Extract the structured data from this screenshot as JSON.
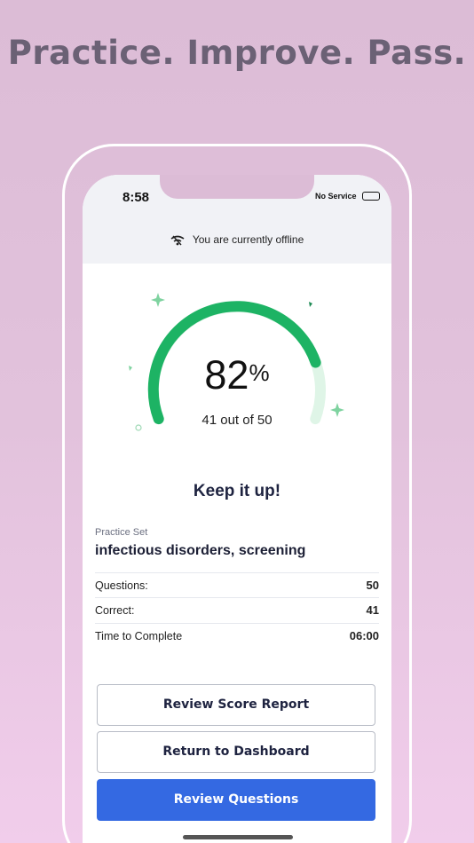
{
  "headline": "Practice. Improve. Pass.",
  "status_bar": {
    "time": "8:58",
    "carrier": "No Service"
  },
  "offline_banner": {
    "text": "You are currently offline",
    "icon": "wifi-off-icon"
  },
  "score": {
    "percent": "82",
    "percent_symbol": "%",
    "fraction": 0.82,
    "detail": "41 out of 50"
  },
  "message": "Keep it up!",
  "practice_set": {
    "label": "Practice Set",
    "name": "infectious disorders, screening"
  },
  "stats": [
    {
      "label": "Questions:",
      "value": "50"
    },
    {
      "label": "Correct:",
      "value": "41"
    },
    {
      "label": "Time to Complete",
      "value": "06:00"
    }
  ],
  "buttons": {
    "review_score": "Review Score Report",
    "dashboard": "Return to Dashboard",
    "review_questions": "Review Questions"
  },
  "colors": {
    "gauge_primary": "#1db364",
    "gauge_track": "#dff5e7",
    "accent_button": "#3469e2"
  }
}
